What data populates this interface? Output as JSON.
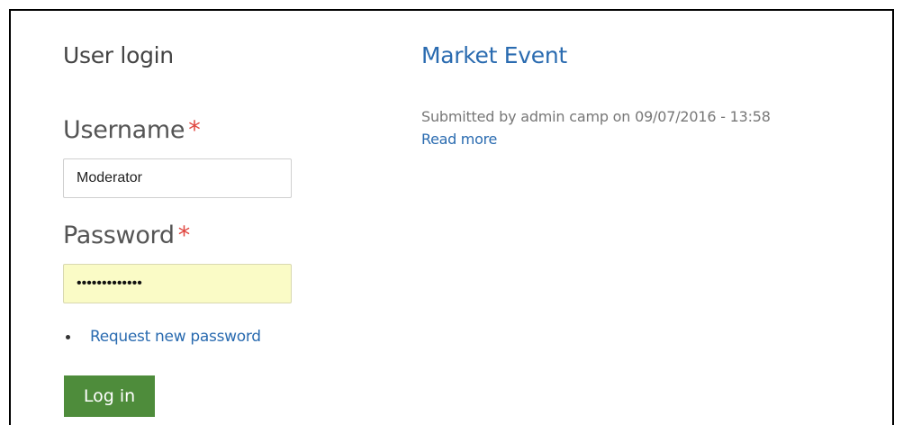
{
  "login": {
    "title": "User login",
    "username_label": "Username",
    "required_mark": "*",
    "username_value": "Moderator",
    "password_label": "Password",
    "password_value": "•••••••••••••",
    "request_password_link": "Request new password",
    "submit_label": "Log in"
  },
  "content": {
    "node_title": "Market Event",
    "submitted_text": "Submitted by admin camp on 09/07/2016 - 13:58",
    "read_more_link": "Read more"
  },
  "colors": {
    "link": "#2a6bb0",
    "required": "#e0463f",
    "button": "#4e8c3b",
    "password_autofill": "#fafbc6"
  }
}
